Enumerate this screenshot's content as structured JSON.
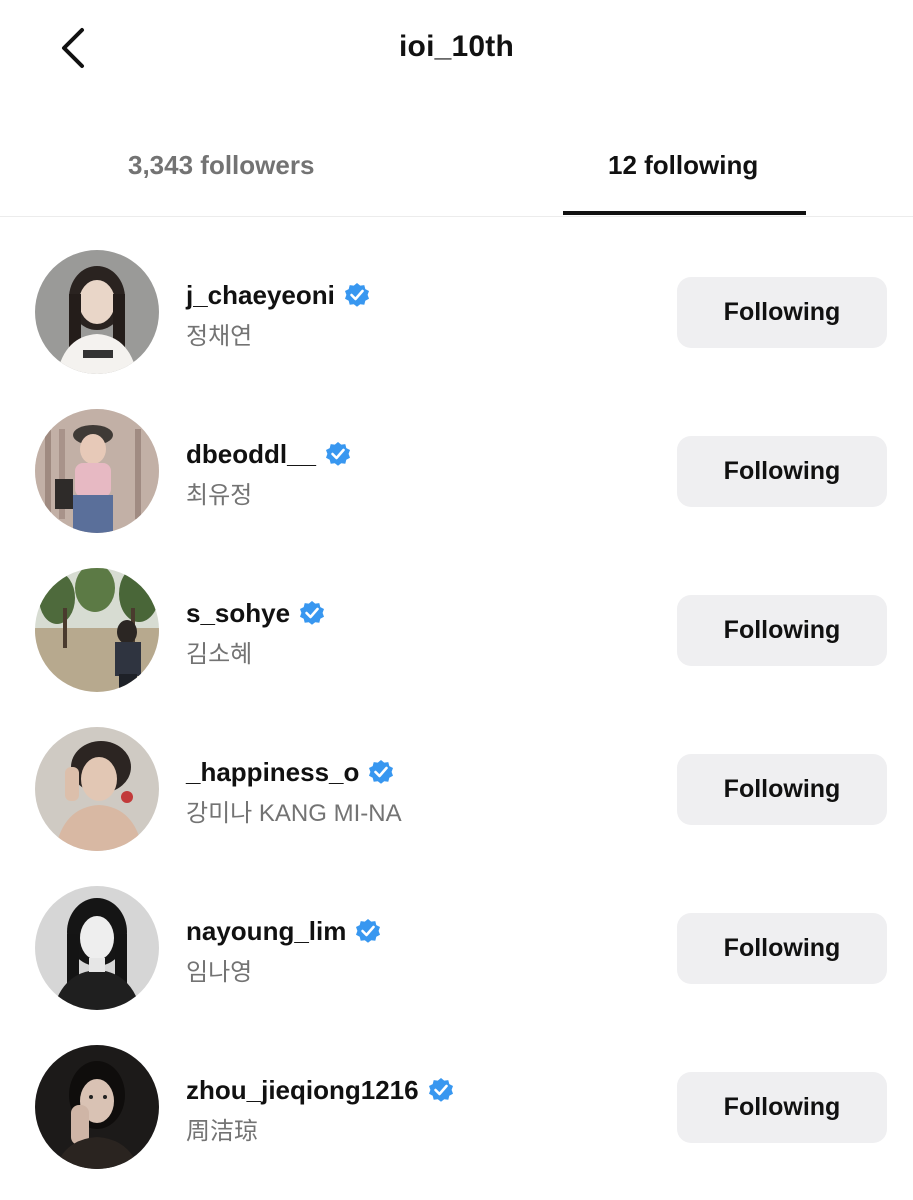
{
  "header": {
    "title": "ioi_10th",
    "back_icon": "chevron-left-icon"
  },
  "tabs": {
    "followers_label": "3,343 followers",
    "following_label": "12 following",
    "active": "following"
  },
  "colors": {
    "verified_badge": "#3897f0",
    "button_bg": "#efeff1",
    "secondary_text": "#737373"
  },
  "accounts": [
    {
      "username": "j_chaeyeoni",
      "full_name": "정채연",
      "verified": true,
      "button_label": "Following"
    },
    {
      "username": "dbeoddl__",
      "full_name": "최유정",
      "verified": true,
      "button_label": "Following"
    },
    {
      "username": "s_sohye",
      "full_name": "김소혜",
      "verified": true,
      "button_label": "Following"
    },
    {
      "username": "_happiness_o",
      "full_name": "강미나  KANG MI-NA",
      "verified": true,
      "button_label": "Following"
    },
    {
      "username": "nayoung_lim",
      "full_name": "임나영",
      "verified": true,
      "button_label": "Following"
    },
    {
      "username": "zhou_jieqiong1216",
      "full_name": "周洁琼",
      "verified": true,
      "button_label": "Following"
    }
  ]
}
